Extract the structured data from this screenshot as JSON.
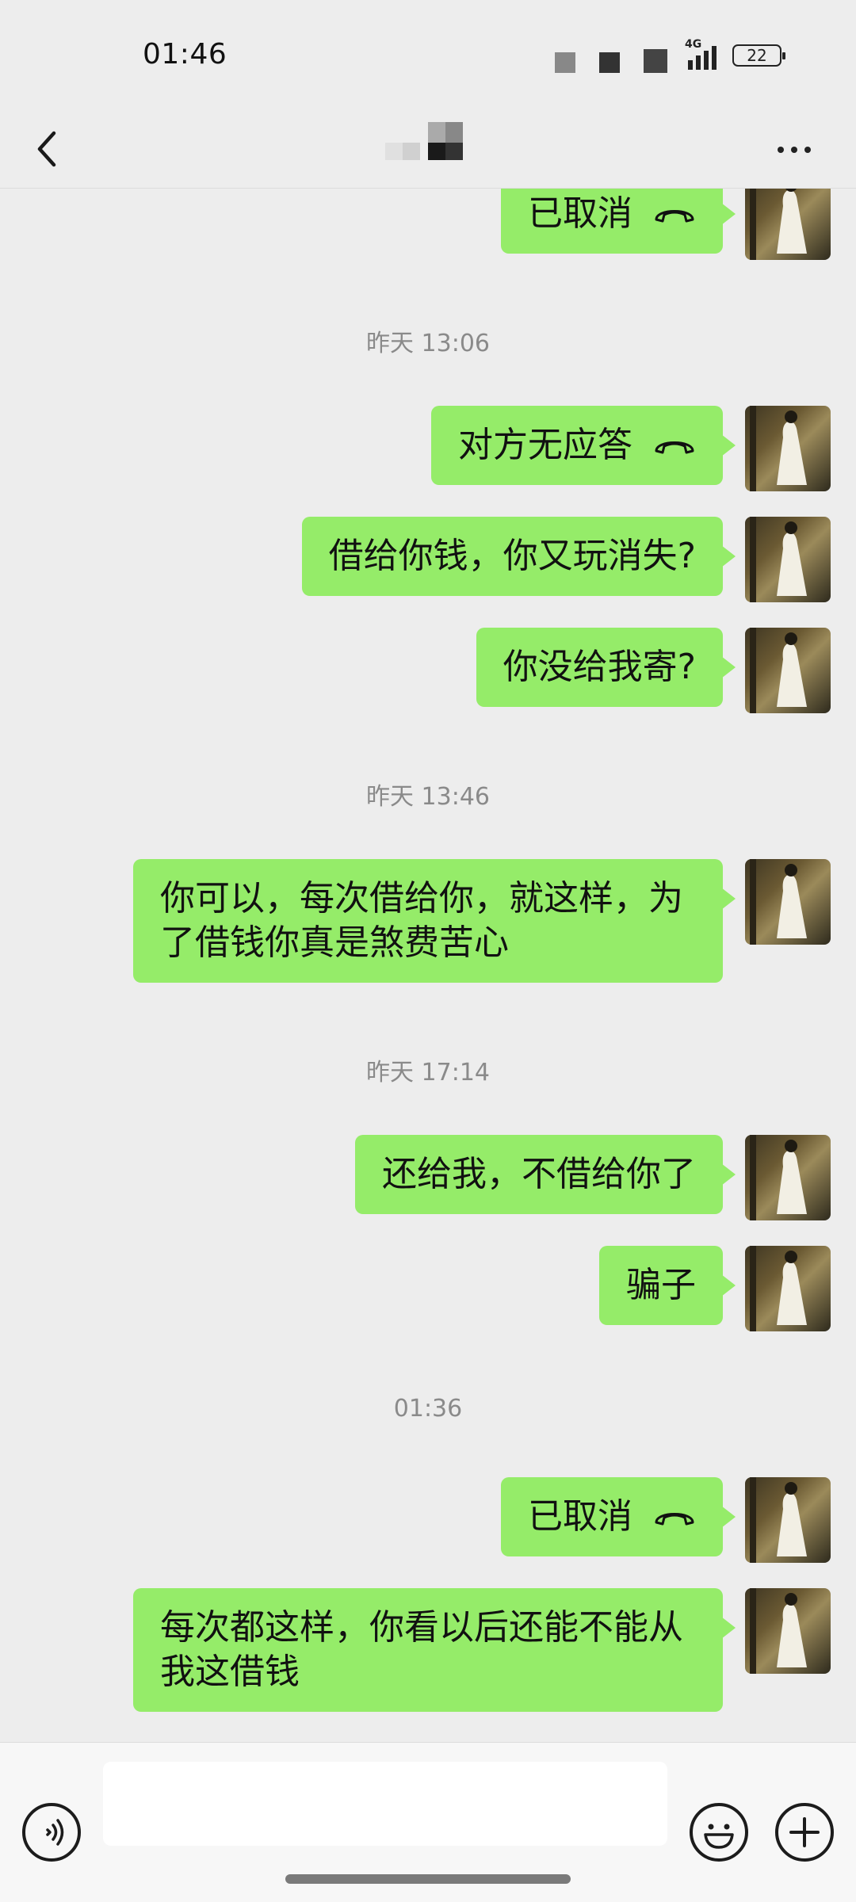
{
  "status_bar": {
    "time": "01:46",
    "network": "4G",
    "battery": "22"
  },
  "messages": [
    {
      "id": "m0",
      "type": "call",
      "text": "已取消"
    },
    {
      "id": "t1",
      "type": "timestamp",
      "text": "昨天 13:06"
    },
    {
      "id": "m1",
      "type": "call",
      "text": "对方无应答"
    },
    {
      "id": "m2",
      "type": "text",
      "text": "借给你钱，你又玩消失?"
    },
    {
      "id": "m3",
      "type": "text",
      "text": "你没给我寄?"
    },
    {
      "id": "t2",
      "type": "timestamp",
      "text": "昨天 13:46"
    },
    {
      "id": "m4",
      "type": "text",
      "text": "你可以，每次借给你，就这样，为了借钱你真是煞费苦心"
    },
    {
      "id": "t3",
      "type": "timestamp",
      "text": "昨天 17:14"
    },
    {
      "id": "m5",
      "type": "text",
      "text": "还给我，不借给你了"
    },
    {
      "id": "m6",
      "type": "text",
      "text": "骗子"
    },
    {
      "id": "t4",
      "type": "timestamp",
      "text": "01:36"
    },
    {
      "id": "m7",
      "type": "call",
      "text": "已取消"
    },
    {
      "id": "m8",
      "type": "text",
      "text": "每次都这样，你看以后还能不能从我这借钱"
    }
  ],
  "icons": {
    "back": "chevron-left-icon",
    "more": "more-dots-icon",
    "call": "phone-hangup-icon",
    "voice": "voice-icon",
    "emoji": "emoji-icon",
    "plus": "plus-icon"
  },
  "colors": {
    "background": "#ededed",
    "bubble_sent": "#95ec69",
    "input_bar": "#f7f7f7",
    "timestamp": "#8a8a8a"
  }
}
